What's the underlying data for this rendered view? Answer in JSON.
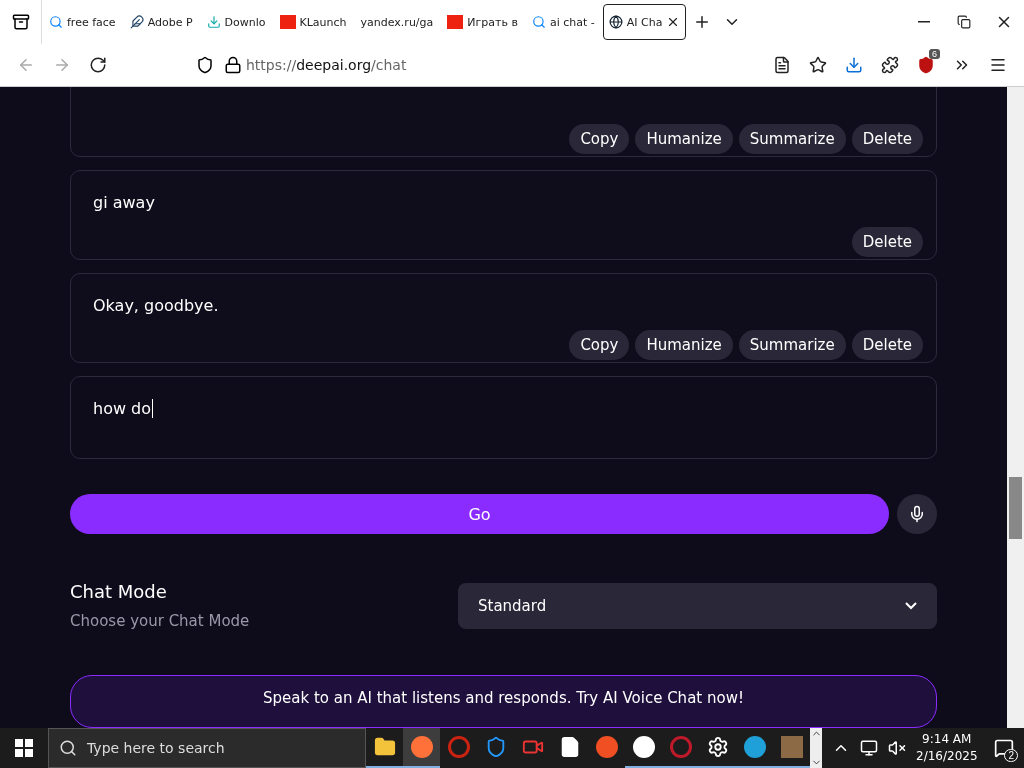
{
  "browser": {
    "tabs": [
      {
        "label": "free face",
        "selected": false
      },
      {
        "label": "Adobe P",
        "selected": false
      },
      {
        "label": "Downlo",
        "selected": false
      },
      {
        "label": "KLaunch",
        "selected": false
      },
      {
        "label": "yandex.ru/ga",
        "selected": false
      },
      {
        "label": "Играть в",
        "selected": false
      },
      {
        "label": "ai chat -",
        "selected": false
      },
      {
        "label": "AI Cha",
        "selected": true
      }
    ],
    "url": {
      "prefix": "https://",
      "domain": "deepai.org",
      "path": "/chat"
    },
    "extension_badge": "6"
  },
  "messages": [
    {
      "actions": [
        "Copy",
        "Humanize",
        "Summarize",
        "Delete"
      ]
    },
    {
      "text": "gi away",
      "actions": [
        "Delete"
      ]
    },
    {
      "text": "Okay, goodbye.",
      "actions": [
        "Copy",
        "Humanize",
        "Summarize",
        "Delete"
      ]
    }
  ],
  "input": {
    "value": "how do"
  },
  "go_button": "Go",
  "chat_mode": {
    "title": "Chat Mode",
    "subtitle": "Choose your Chat Mode",
    "value": "Standard"
  },
  "banner": "Speak to an AI that listens and responds. Try AI Voice Chat now!",
  "taskbar": {
    "search_placeholder": "Type here to search",
    "apps": [
      {
        "running": true,
        "selected": false
      },
      {
        "running": true,
        "selected": true
      },
      {
        "running": false,
        "selected": false
      },
      {
        "running": false,
        "selected": false
      },
      {
        "running": false,
        "selected": false
      },
      {
        "running": false,
        "selected": false
      },
      {
        "running": false,
        "selected": false
      },
      {
        "running": true,
        "selected": false
      },
      {
        "running": true,
        "selected": false
      },
      {
        "running": true,
        "selected": false
      },
      {
        "running": true,
        "selected": false
      },
      {
        "running": true,
        "selected": false
      }
    ],
    "time": "9:14 AM",
    "date": "2/16/2025",
    "notifications": "2"
  }
}
